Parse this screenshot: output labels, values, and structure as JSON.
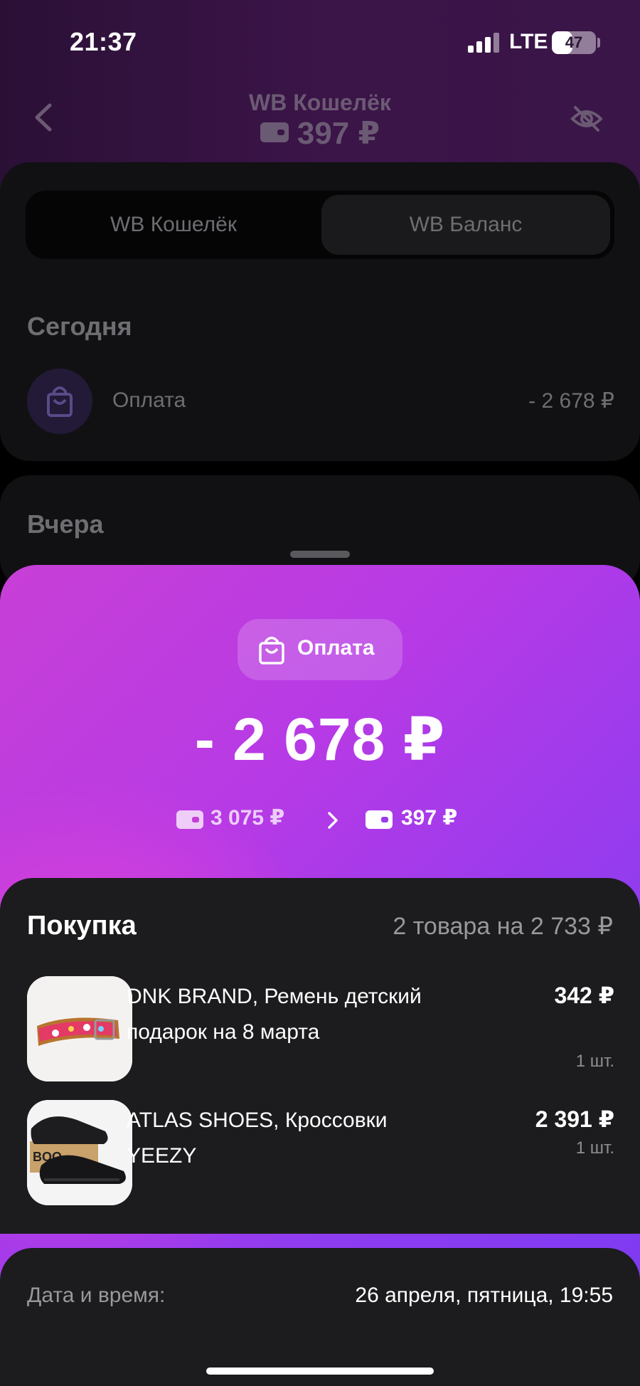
{
  "status_bar": {
    "time": "21:37",
    "network": "LTE",
    "battery": "47",
    "battery_level": 0.47,
    "signal_bars_active": 4
  },
  "header": {
    "back_icon": "chevron-left-icon",
    "title": "WB Кошелёк",
    "balance": "397 ₽",
    "visibility_icon": "eye-off-icon"
  },
  "tabs": [
    {
      "label": "WB Кошелёк",
      "selected": false
    },
    {
      "label": "WB Баланс",
      "selected": true
    }
  ],
  "history": {
    "today_heading": "Сегодня",
    "today_items": [
      {
        "icon": "shopping-bag-icon",
        "label": "Оплата",
        "amount": "- 2 678 ₽"
      }
    ],
    "yesterday_heading": "Вчера"
  },
  "sheet": {
    "type_icon": "shopping-bag-icon",
    "type_label": "Оплата",
    "amount": "- 2 678 ₽",
    "balance_before": "3 075 ₽",
    "balance_after": "397 ₽",
    "purchase": {
      "title": "Покупка",
      "summary": "2 товара на 2 733 ₽",
      "items": [
        {
          "name": "DNK BRAND, Ремень детский подарок на 8 марта",
          "price": "342 ₽",
          "qty": "1 шт.",
          "thumb": "belt-photo"
        },
        {
          "name": "ATLAS SHOES, Кроссовки YEEZY",
          "price": "2 391 ₽",
          "qty": "1 шт.",
          "thumb": "sneakers-photo"
        }
      ]
    },
    "details": {
      "date_label": "Дата и время:",
      "date_value": "26 апреля, пятница, 19:55"
    }
  },
  "colors": {
    "sheet_gradient_start": "#c83fd6",
    "sheet_gradient_end": "#7a3af2",
    "card_bg": "#1c1c1e",
    "background": "#000000"
  }
}
